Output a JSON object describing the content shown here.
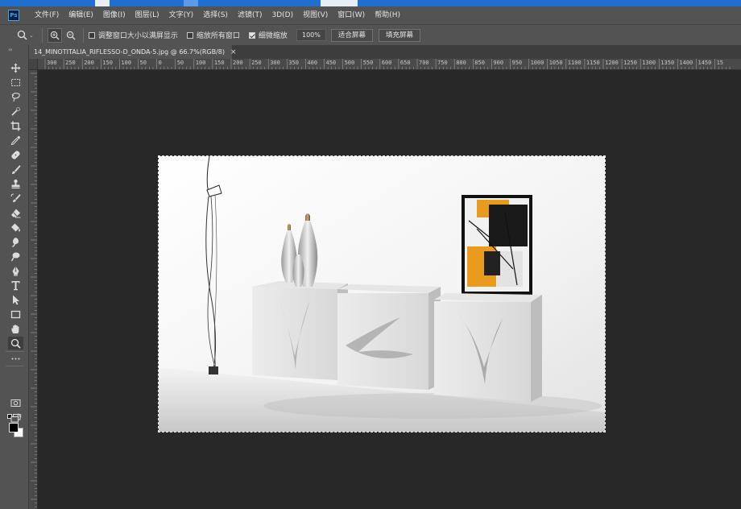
{
  "menubar": {
    "logo": "Ps",
    "items": [
      "文件(F)",
      "编辑(E)",
      "图像(I)",
      "图层(L)",
      "文字(Y)",
      "选择(S)",
      "滤镜(T)",
      "3D(D)",
      "视图(V)",
      "窗口(W)",
      "帮助(H)"
    ]
  },
  "options": {
    "tool_icon": "zoom-icon",
    "resize_windows_label": "调整窗口大小以满屏显示",
    "resize_windows_checked": false,
    "zoom_all_label": "缩放所有窗口",
    "zoom_all_checked": false,
    "scrubby_zoom_label": "细微缩放",
    "scrubby_zoom_checked": true,
    "zoom_value": "100%",
    "fit_screen_label": "适合屏幕",
    "fill_screen_label": "填充屏幕"
  },
  "document": {
    "tab_title": "14_MINOTITALIA_RIFLESSO-D_ONDA-5.jpg @ 66.7%(RGB/8)",
    "close_glyph": "×"
  },
  "rulers": {
    "horizontal_labels": [
      "300",
      "250",
      "200",
      "150",
      "100",
      "50",
      "0",
      "50",
      "100",
      "150",
      "200",
      "250",
      "300",
      "350",
      "400",
      "450",
      "500",
      "550",
      "600",
      "650",
      "700",
      "750",
      "800",
      "850",
      "900",
      "950",
      "1000",
      "1050",
      "1100",
      "1150",
      "1200",
      "1250",
      "1300",
      "1350",
      "1400",
      "1450",
      "15"
    ]
  },
  "colors": {
    "foreground": "#000000",
    "background": "#ffffff",
    "accent": "#31a8ff"
  },
  "tools": [
    "move-icon",
    "marquee-icon",
    "lasso-icon",
    "quick-select-icon",
    "crop-icon",
    "eyedropper-icon",
    "healing-brush-icon",
    "brush-icon",
    "clone-stamp-icon",
    "history-brush-icon",
    "eraser-icon",
    "paint-bucket-icon",
    "blur-icon",
    "dodge-icon",
    "pen-icon",
    "type-icon",
    "path-select-icon",
    "rectangle-icon",
    "hand-icon",
    "zoom-icon",
    "more-tools-icon"
  ]
}
